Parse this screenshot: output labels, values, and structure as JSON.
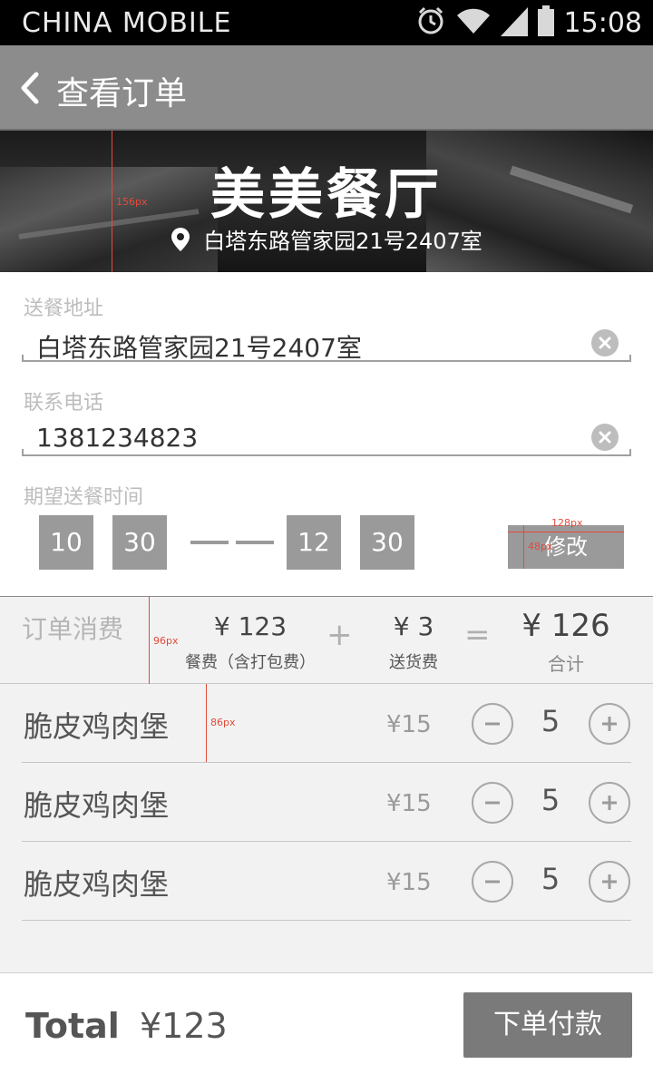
{
  "status_bar": {
    "carrier": "CHINA  MOBILE",
    "time": "15:08",
    "icons": [
      "alarm-icon",
      "wifi-icon",
      "signal-icon",
      "battery-icon"
    ]
  },
  "nav": {
    "title": "查看订单",
    "back_icon": "chevron-left-icon"
  },
  "banner": {
    "restaurant_name": "美美餐厅",
    "address": "白塔东路管家园21号2407室",
    "location_icon": "map-pin-icon",
    "height_note": "156px"
  },
  "form": {
    "address_label": "送餐地址",
    "address_value": "白塔东路管家园21号2407室",
    "phone_label": "联系电话",
    "phone_value": "1381234823",
    "time_label": "期望送餐时间",
    "time_start_hour": "10",
    "time_start_min": "30",
    "time_end_hour": "12",
    "time_end_min": "30",
    "modify_label": "修改",
    "modify_width_note": "128px",
    "modify_height_note": "48px"
  },
  "summary": {
    "title": "订单消费",
    "height_note": "96px",
    "food_amount": "¥  123",
    "food_caption": "餐费（含打包费）",
    "plus": "+",
    "delivery_amount": "¥ 3",
    "delivery_caption": "送货费",
    "equals": "=",
    "total_amount": "¥ 126",
    "total_caption": "合计"
  },
  "items": [
    {
      "name": "脆皮鸡肉堡",
      "price": "¥15",
      "qty": "5"
    },
    {
      "name": "脆皮鸡肉堡",
      "price": "¥15",
      "qty": "5"
    },
    {
      "name": "脆皮鸡肉堡",
      "price": "¥15",
      "qty": "5"
    }
  ],
  "item_height_note": "86px",
  "bottom": {
    "total_label": "Total",
    "total_value": "¥123",
    "pay_label": "下单付款"
  },
  "colors": {
    "nav_bg": "#8c8c8c",
    "button_gray": "#9a9a9a",
    "pay_button": "#7a7a7a",
    "annotation_red": "#e24a3b"
  }
}
